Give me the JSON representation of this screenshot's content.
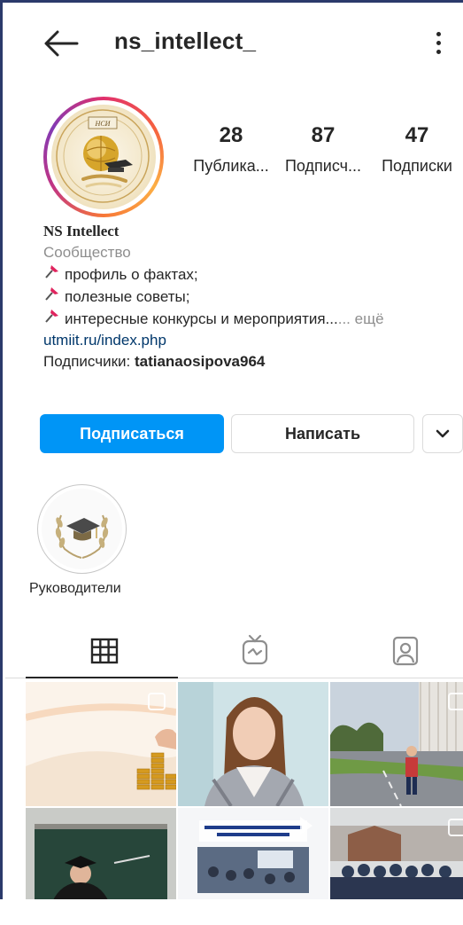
{
  "header": {
    "username": "ns_intellect_",
    "back_icon": "arrow-left-icon",
    "menu_icon": "more-vertical-icon"
  },
  "profile": {
    "stats": [
      {
        "count": "28",
        "label": "Публика..."
      },
      {
        "count": "87",
        "label": "Подписч..."
      },
      {
        "count": "47",
        "label": "Подписки"
      }
    ],
    "name": "NS Intellect",
    "category": "Сообщество",
    "bio_lines": [
      "профиль о фактах;",
      "полезные советы;",
      "интересные конкурсы и мероприятия..."
    ],
    "more_label": "... ещё",
    "link": "utmiit.ru/index.php",
    "followers_prefix": "Подписчики: ",
    "followers_user": "tatianaosipova964"
  },
  "actions": {
    "follow_label": "Подписаться",
    "message_label": "Написать"
  },
  "highlights": [
    {
      "label": "Руководители"
    }
  ],
  "colors": {
    "accent": "#0095f6",
    "link": "#00376b",
    "muted": "#8e8e8e",
    "text": "#262626",
    "border": "#dbdbdb"
  }
}
